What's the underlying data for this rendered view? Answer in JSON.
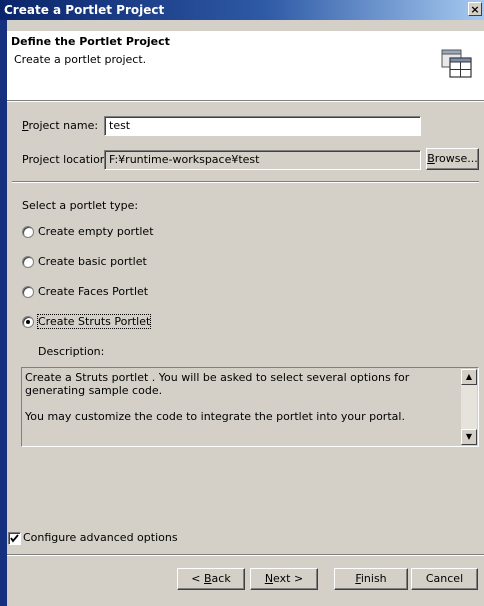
{
  "window": {
    "title": "Create a Portlet Project",
    "close_glyph": "×"
  },
  "header": {
    "title": "Define the Portlet Project",
    "subtitle": "Create a portlet project.",
    "icon": "portlet-project-wizard-icon"
  },
  "project": {
    "name_label": "Project name:",
    "name_value": "test",
    "location_label": "Project location:",
    "location_value": "F:¥runtime-workspace¥test",
    "browse_label": "Browse..."
  },
  "portlet_type": {
    "label": "Select a portlet type:",
    "options": [
      {
        "label": "Create empty portlet",
        "selected": false
      },
      {
        "label": "Create basic portlet",
        "selected": false
      },
      {
        "label": "Create Faces Portlet",
        "selected": false
      },
      {
        "label": "Create Struts Portlet",
        "selected": true
      }
    ]
  },
  "description": {
    "label": "Description:",
    "para1": "Create a Struts portlet . You will be asked to select several options for generating sample code.",
    "para2": "You may customize the code to integrate the portlet into your portal."
  },
  "advanced": {
    "label": "Configure advanced options",
    "checked": true
  },
  "buttons": {
    "back": "< Back",
    "next": "Next >",
    "finish": "Finish",
    "cancel": "Cancel"
  },
  "colors": {
    "title_bar": "#0a246a",
    "left_strip": "#14307e",
    "dialog_bg": "#d4d0c8"
  }
}
